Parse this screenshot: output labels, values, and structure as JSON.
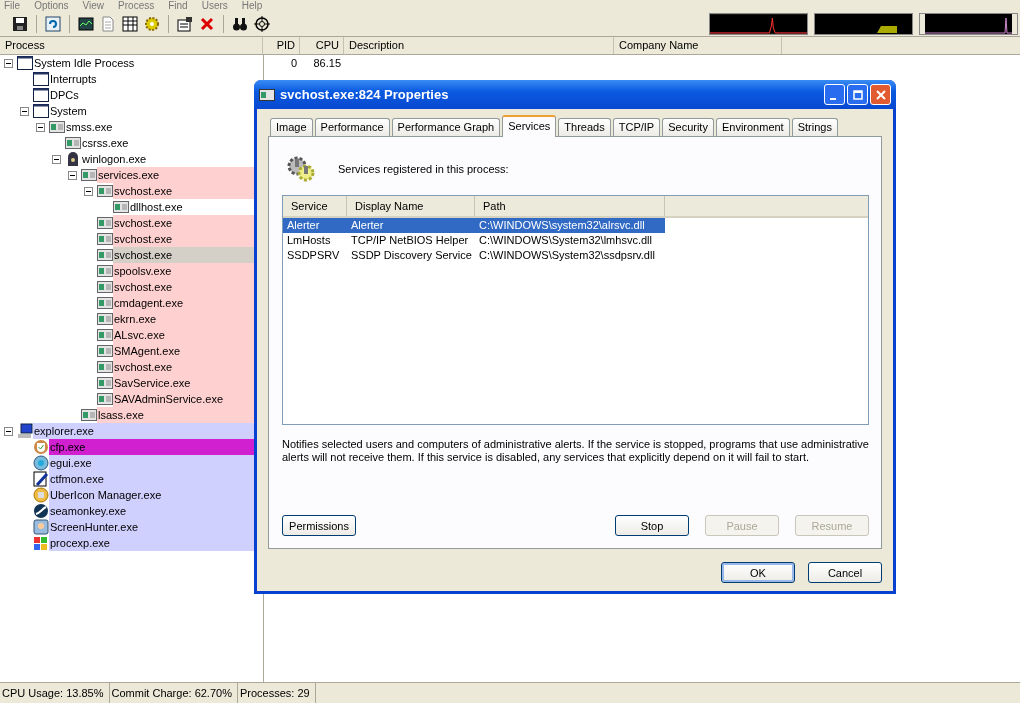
{
  "menu": [
    "File",
    "Options",
    "View",
    "Process",
    "Find",
    "Users",
    "Help"
  ],
  "process_table": {
    "columns": [
      "Process",
      "PID",
      "CPU",
      "Description",
      "Company Name"
    ],
    "rows": [
      {
        "name": "System Idle Process",
        "pid": "0",
        "cpu": "86.15",
        "kind": "window",
        "expanded": true,
        "children": [
          {
            "name": "Interrupts",
            "kind": "window"
          },
          {
            "name": "DPCs",
            "kind": "window"
          },
          {
            "name": "System",
            "kind": "window",
            "expanded": true,
            "children": [
              {
                "name": "smss.exe",
                "kind": "app",
                "expanded": true,
                "children": [
                  {
                    "name": "csrss.exe",
                    "kind": "app"
                  },
                  {
                    "name": "winlogon.exe",
                    "kind": "winlogon",
                    "expanded": true,
                    "children": [
                      {
                        "name": "services.exe",
                        "kind": "app",
                        "color": "#ffd0d0",
                        "expanded": true,
                        "children": [
                          {
                            "name": "svchost.exe",
                            "kind": "app",
                            "color": "#ffd0d0",
                            "expanded": true,
                            "children": [
                              {
                                "name": "dllhost.exe",
                                "kind": "app"
                              }
                            ]
                          },
                          {
                            "name": "svchost.exe",
                            "kind": "app",
                            "color": "#ffd0d0"
                          },
                          {
                            "name": "svchost.exe",
                            "kind": "app",
                            "color": "#ffd0d0"
                          },
                          {
                            "name": "svchost.exe",
                            "kind": "app",
                            "color": "#d4d0c8"
                          },
                          {
                            "name": "spoolsv.exe",
                            "kind": "app",
                            "color": "#ffd0d0"
                          },
                          {
                            "name": "svchost.exe",
                            "kind": "app",
                            "color": "#ffd0d0"
                          },
                          {
                            "name": "cmdagent.exe",
                            "kind": "app",
                            "color": "#ffd0d0"
                          },
                          {
                            "name": "ekrn.exe",
                            "kind": "app",
                            "color": "#ffd0d0"
                          },
                          {
                            "name": "ALsvc.exe",
                            "kind": "app",
                            "color": "#ffd0d0"
                          },
                          {
                            "name": "SMAgent.exe",
                            "kind": "app",
                            "color": "#ffd0d0"
                          },
                          {
                            "name": "svchost.exe",
                            "kind": "app",
                            "color": "#ffd0d0"
                          },
                          {
                            "name": "SavService.exe",
                            "kind": "app",
                            "color": "#ffd0d0"
                          },
                          {
                            "name": "SAVAdminService.exe",
                            "kind": "app",
                            "color": "#ffd0d0"
                          }
                        ]
                      },
                      {
                        "name": "lsass.exe",
                        "kind": "app",
                        "color": "#ffd0d0"
                      }
                    ]
                  }
                ]
              }
            ]
          }
        ]
      },
      {
        "name": "explorer.exe",
        "kind": "computer",
        "color": "#d0d0ff",
        "expanded": true,
        "children": [
          {
            "name": "cfp.exe",
            "kind": "shield",
            "color": "#d020d0"
          },
          {
            "name": "egui.exe",
            "kind": "disc",
            "color": "#d0d0ff"
          },
          {
            "name": "ctfmon.exe",
            "kind": "pen",
            "color": "#d0d0ff"
          },
          {
            "name": "UberIcon Manager.exe",
            "kind": "smiley",
            "color": "#d0d0ff"
          },
          {
            "name": "seamonkey.exe",
            "kind": "swirl",
            "color": "#d0d0ff"
          },
          {
            "name": "ScreenHunter.exe",
            "kind": "monitor",
            "color": "#d0d0ff"
          },
          {
            "name": "procexp.exe",
            "kind": "squares",
            "color": "#d0d0ff"
          }
        ]
      }
    ]
  },
  "dialog": {
    "title": "svchost.exe:824 Properties",
    "tabs": [
      {
        "label": "Image",
        "selected": false
      },
      {
        "label": "Performance",
        "selected": false
      },
      {
        "label": "Performance Graph",
        "selected": false
      },
      {
        "label": "Services",
        "selected": true
      },
      {
        "label": "Threads",
        "selected": false
      },
      {
        "label": "TCP/IP",
        "selected": false
      },
      {
        "label": "Security",
        "selected": false
      },
      {
        "label": "Environment",
        "selected": false
      },
      {
        "label": "Strings",
        "selected": false
      }
    ],
    "heading": "Services registered in this process:",
    "services": {
      "columns": [
        "Service",
        "Display Name",
        "Path"
      ],
      "rows": [
        {
          "service": "Alerter",
          "display_name": "Alerter",
          "path": "C:\\WINDOWS\\system32\\alrsvc.dll",
          "selected": true
        },
        {
          "service": "LmHosts",
          "display_name": "TCP/IP NetBIOS Helper",
          "path": "C:\\WINDOWS\\System32\\lmhsvc.dll",
          "selected": false
        },
        {
          "service": "SSDPSRV",
          "display_name": "SSDP Discovery Service",
          "path": "C:\\WINDOWS\\System32\\ssdpsrv.dll",
          "selected": false
        }
      ]
    },
    "description": "Notifies selected users and computers of administrative alerts. If the service is stopped, programs that use administrative alerts will not receive them. If this service is disabled, any services that explicitly depend on it will fail to start.",
    "left_button": "Permissions",
    "service_buttons": [
      {
        "label": "Stop",
        "disabled": false
      },
      {
        "label": "Pause",
        "disabled": true
      },
      {
        "label": "Resume",
        "disabled": true
      }
    ],
    "footer_buttons": [
      {
        "label": "OK",
        "default": true
      },
      {
        "label": "Cancel",
        "default": false
      }
    ]
  },
  "status_bar": [
    "CPU Usage: 13.85%",
    "Commit Charge: 62.70%",
    "Processes: 29"
  ]
}
